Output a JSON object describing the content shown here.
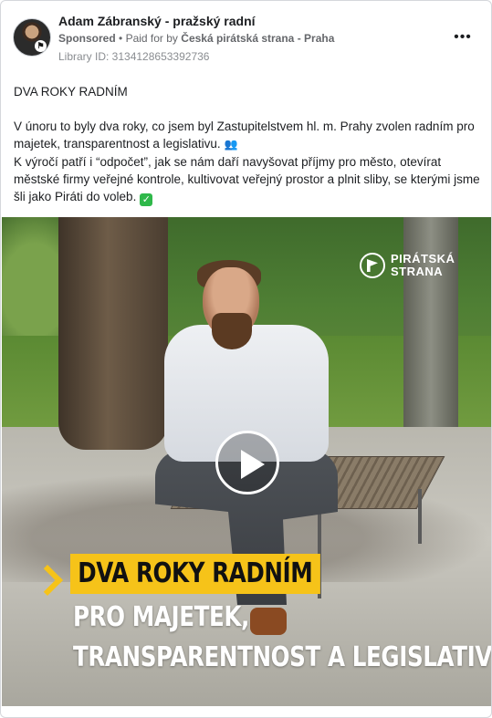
{
  "post": {
    "page_name": "Adam Zábranský - pražský radní",
    "sponsored": "Sponsored",
    "paid_for_prefix": "Paid for by",
    "payer": "Česká pirátská strana - Praha",
    "library_id": "Library ID: 3134128653392736",
    "more_icon": "more-horizontal-icon"
  },
  "body": {
    "title": "DVA ROKY RADNÍM",
    "paragraph1": "V únoru to byly dva roky, co jsem byl Zastupitelstvem hl. m. Prahy zvolen radním pro majetek, transparentnost a legislativu.",
    "paragraph2": "K výročí patří i “odpočet”, jak se nám daří navyšovat příjmy pro město, otevírat městské firmy veřejné kontrole, kultivovat veřejný prostor a plnit sliby, se kterými jsme šli jako Piráti do voleb."
  },
  "media": {
    "logo_line1": "PIRÁTSKÁ",
    "logo_line2": "STRANA",
    "headline_highlight": "DVA ROKY RADNÍM",
    "headline_line2": "PRO MAJETEK,",
    "headline_line3": "TRANSPARENTNOST A LEGISLATIVU",
    "highlight_color": "#f6c319"
  }
}
